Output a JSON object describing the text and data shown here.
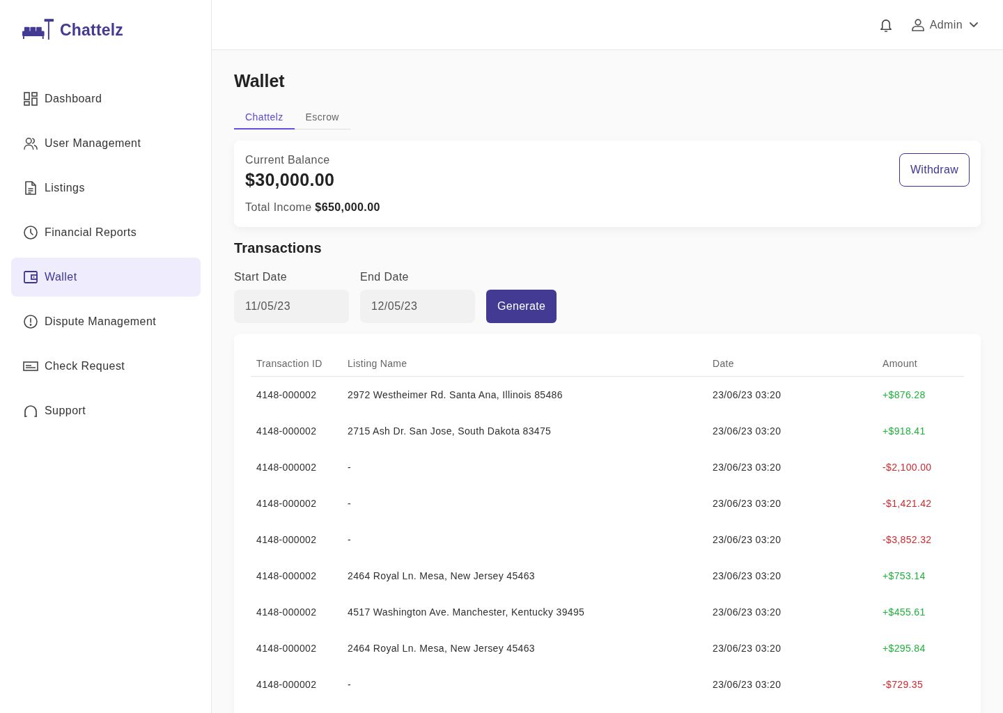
{
  "sidebar": {
    "logo": "Chattelz",
    "items": [
      {
        "label": "Dashboard",
        "selected": false
      },
      {
        "label": "User Management",
        "selected": false
      },
      {
        "label": "Listings",
        "selected": false
      },
      {
        "label": "Financial Reports",
        "selected": false
      },
      {
        "label": "Wallet",
        "selected": true
      },
      {
        "label": "Dispute Management",
        "selected": false
      },
      {
        "label": "Check Request",
        "selected": false
      },
      {
        "label": "Support",
        "selected": false
      }
    ]
  },
  "topbar": {
    "user": "Admin"
  },
  "page": {
    "title": "Wallet"
  },
  "tabs": [
    {
      "label": "Chattelz",
      "selected": true
    },
    {
      "label": "Escrow",
      "selected": false
    }
  ],
  "balance_card": {
    "label": "Current Balance",
    "amount": "$30,000.00",
    "total_income": "Total Income **$650,000.00**",
    "button": "Withdraw"
  },
  "transactions": {
    "title": "Transactions",
    "filters": [
      {
        "label": "Start Date",
        "value": "11/05/23"
      },
      {
        "label": "End Date",
        "value": "12/05/23"
      }
    ],
    "button": "Generate"
  },
  "table": {
    "columns": [
      "Transaction ID",
      "Listing Name",
      "Date",
      "Amount"
    ],
    "rows": [
      {
        "id": "4148-000002",
        "listing": "2972 Westheimer Rd. Santa Ana, Illinois 85486",
        "date": "23/06/23 03:20",
        "amount": "+$876.28",
        "kind": "credit"
      },
      {
        "id": "4148-000002",
        "listing": "2715 Ash Dr. San Jose, South Dakota 83475",
        "date": "23/06/23 03:20",
        "amount": "+$918.41",
        "kind": "credit"
      },
      {
        "id": "4148-000002",
        "listing": "-",
        "date": "23/06/23 03:20",
        "amount": "-$2,100.00",
        "kind": "debit"
      },
      {
        "id": "4148-000002",
        "listing": "-",
        "date": "23/06/23 03:20",
        "amount": "-$1,421.42",
        "kind": "debit"
      },
      {
        "id": "4148-000002",
        "listing": "-",
        "date": "23/06/23 03:20",
        "amount": "-$3,852.32",
        "kind": "debit"
      },
      {
        "id": "4148-000002",
        "listing": "2464 Royal Ln. Mesa, New Jersey 45463",
        "date": "23/06/23 03:20",
        "amount": "+$753.14",
        "kind": "credit"
      },
      {
        "id": "4148-000002",
        "listing": "4517 Washington Ave. Manchester, Kentucky 39495",
        "date": "23/06/23 03:20",
        "amount": "+$455.61",
        "kind": "credit"
      },
      {
        "id": "4148-000002",
        "listing": "2464 Royal Ln. Mesa, New Jersey 45463",
        "date": "23/06/23 03:20",
        "amount": "+$295.84",
        "kind": "credit"
      },
      {
        "id": "4148-000002",
        "listing": "-",
        "date": "23/06/23 03:20",
        "amount": "-$729.35",
        "kind": "debit"
      }
    ]
  }
}
